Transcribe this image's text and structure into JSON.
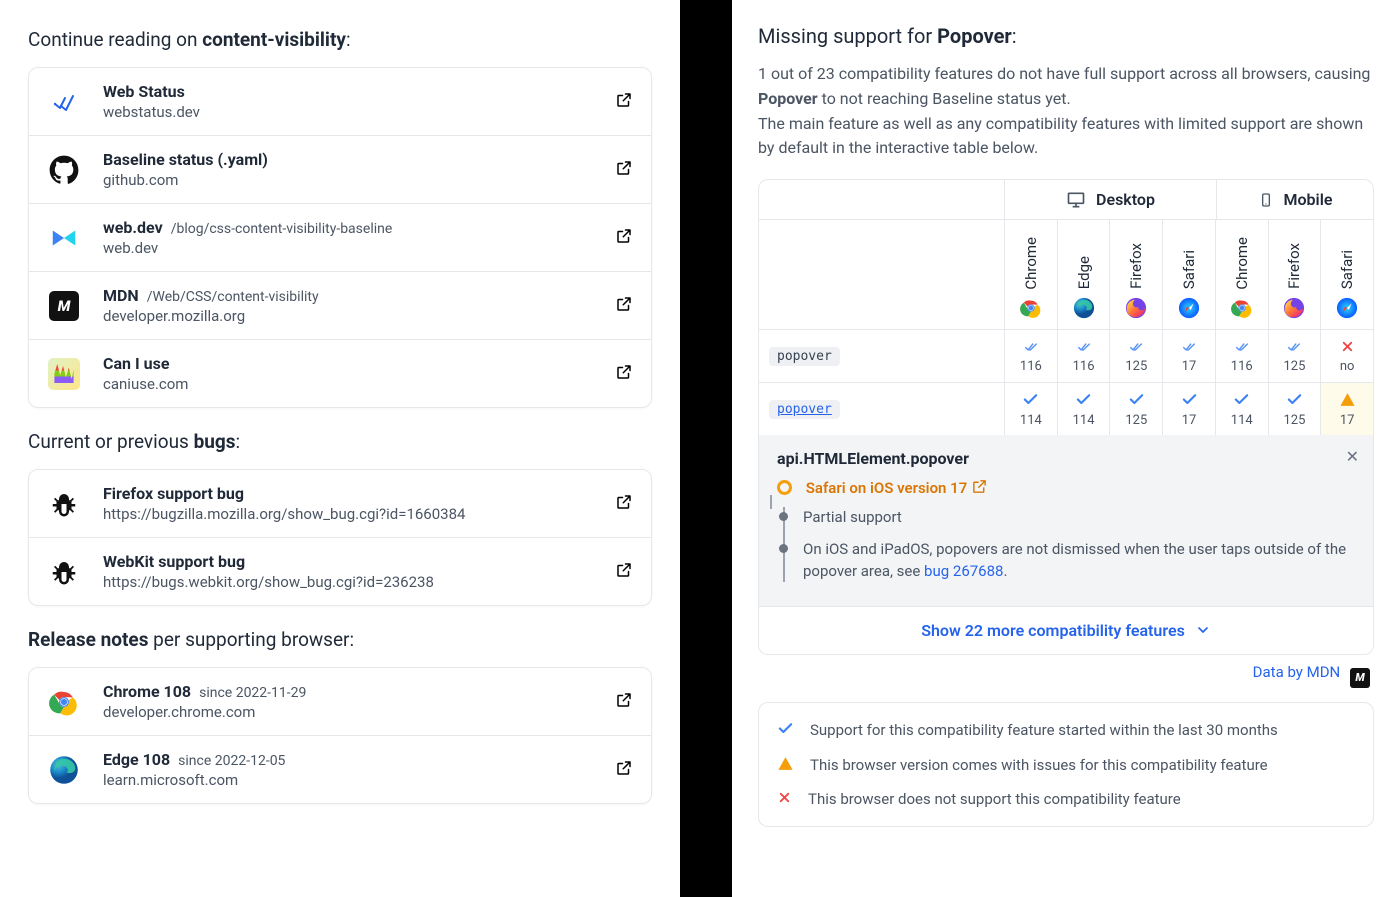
{
  "left": {
    "heading_prefix": "Continue reading on ",
    "heading_bold": "content-visibility",
    "heading_suffix": ":",
    "links": [
      {
        "icon": "status",
        "title": "Web Status",
        "path": "",
        "sub": "webstatus.dev"
      },
      {
        "icon": "github",
        "title": "Baseline status (.yaml)",
        "path": "",
        "sub": "github.com"
      },
      {
        "icon": "webdev",
        "title": "web.dev",
        "path": "/blog/css-content-visibility-baseline",
        "sub": "web.dev"
      },
      {
        "icon": "mdn",
        "title": "MDN",
        "path": "/Web/CSS/content-visibility",
        "sub": "developer.mozilla.org"
      },
      {
        "icon": "caniuse",
        "title": "Can I use",
        "path": "",
        "sub": "caniuse.com"
      }
    ],
    "bugs_heading_prefix": "Current or previous ",
    "bugs_heading_bold": "bugs",
    "bugs_heading_suffix": ":",
    "bugs": [
      {
        "title": "Firefox support bug",
        "url": "https://bugzilla.mozilla.org/show_bug.cgi?id=1660384"
      },
      {
        "title": "WebKit support bug",
        "url": "https://bugs.webkit.org/show_bug.cgi?id=236238"
      }
    ],
    "release_heading_bold": "Release notes",
    "release_heading_suffix": " per supporting browser:",
    "releases": [
      {
        "icon": "chrome",
        "title": "Chrome 108",
        "since": "since 2022-11-29",
        "sub": "developer.chrome.com"
      },
      {
        "icon": "edge",
        "title": "Edge 108",
        "since": "since 2022-12-05",
        "sub": "learn.microsoft.com"
      }
    ]
  },
  "right": {
    "heading_prefix": "Missing support for ",
    "heading_bold": "Popover",
    "heading_suffix": ":",
    "para1_a": "1 out of 23 compatibility features do not have full support across all browsers, causing ",
    "para1_bold": "Popover",
    "para1_b": " to not reaching Baseline status yet.",
    "para2": "The main feature as well as any compatibility features with limited support are shown by default in the interactive table below.",
    "table": {
      "desktop_label": "Desktop",
      "mobile_label": "Mobile",
      "browsers": [
        "Chrome",
        "Edge",
        "Firefox",
        "Safari",
        "Chrome",
        "Firefox",
        "Safari"
      ],
      "rows": [
        {
          "feature": "popover",
          "link": false,
          "cells": [
            {
              "s": "chkd",
              "v": "116"
            },
            {
              "s": "chkd",
              "v": "116"
            },
            {
              "s": "chkd",
              "v": "125"
            },
            {
              "s": "chkd",
              "v": "17"
            },
            {
              "s": "chkd",
              "v": "116"
            },
            {
              "s": "chkd",
              "v": "125"
            },
            {
              "s": "cross",
              "v": "no"
            }
          ]
        },
        {
          "feature": "popover",
          "link": true,
          "cells": [
            {
              "s": "chk",
              "v": "114"
            },
            {
              "s": "chk",
              "v": "114"
            },
            {
              "s": "chk",
              "v": "125"
            },
            {
              "s": "chk",
              "v": "17"
            },
            {
              "s": "chk",
              "v": "114"
            },
            {
              "s": "chk",
              "v": "125"
            },
            {
              "s": "warn",
              "v": "17",
              "hl": true
            }
          ]
        }
      ]
    },
    "detail": {
      "title": "api.HTMLElement.popover",
      "safari": "Safari on iOS version 17",
      "partial": "Partial support",
      "note_a": "On iOS and iPadOS, popovers are not dismissed when the user taps outside of the popover area, see ",
      "note_link": "bug 267688",
      "note_b": "."
    },
    "show_more": "Show 22 more compatibility features",
    "data_by": "Data by MDN",
    "legend": [
      {
        "icon": "chk",
        "text": "Support for this compatibility feature started within the last 30 months"
      },
      {
        "icon": "warn",
        "text": "This browser version comes with issues for this compatibility feature"
      },
      {
        "icon": "cross",
        "text": "This browser does not support this compatibility feature"
      }
    ]
  }
}
